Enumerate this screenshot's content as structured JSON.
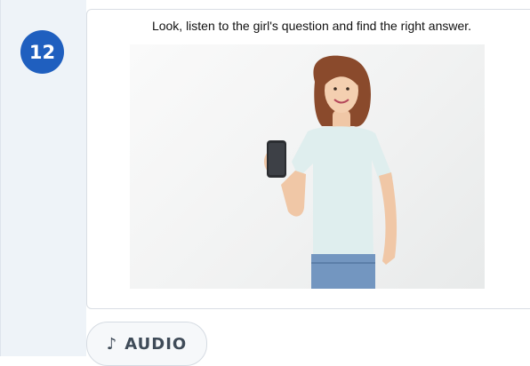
{
  "question": {
    "number": "12",
    "instruction": "Look, listen to the girl's question and find the right answer."
  },
  "media": {
    "photo_subject": "girl-holding-smartphone",
    "audio_icon": "music-note-icon",
    "audio_icon_glyph": "♪",
    "audio_label": "AUDIO"
  },
  "colors": {
    "badge": "#1f5fbf",
    "rail": "#eef3f8",
    "shirt": "#dfeeee",
    "jeans": "#7396c0",
    "hair": "#8a4a2c"
  }
}
